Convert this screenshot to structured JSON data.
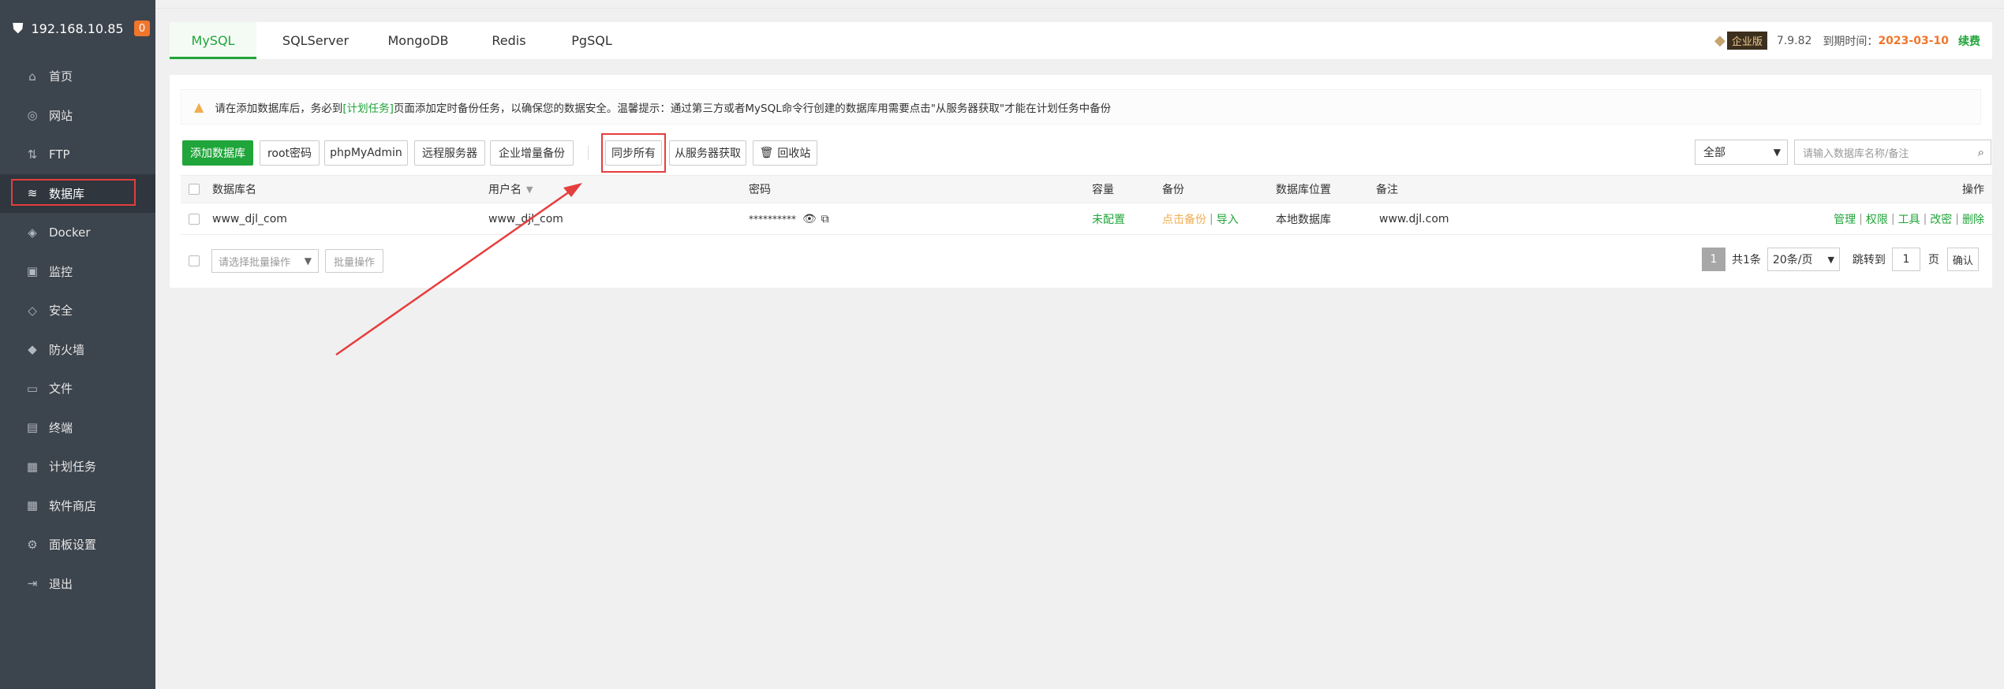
{
  "sidebar": {
    "ip": "192.168.10.85",
    "badge": "0",
    "items": [
      {
        "label": "首页",
        "icon": "home-icon",
        "glyph": "⌂"
      },
      {
        "label": "网站",
        "icon": "globe-icon",
        "glyph": "◎"
      },
      {
        "label": "FTP",
        "icon": "ftp-icon",
        "glyph": "⇅"
      },
      {
        "label": "数据库",
        "icon": "database-icon",
        "glyph": "≋"
      },
      {
        "label": "Docker",
        "icon": "docker-icon",
        "glyph": "◈"
      },
      {
        "label": "监控",
        "icon": "monitor-icon",
        "glyph": "▣"
      },
      {
        "label": "安全",
        "icon": "shield-icon",
        "glyph": "◇"
      },
      {
        "label": "防火墙",
        "icon": "firewall-icon",
        "glyph": "◆"
      },
      {
        "label": "文件",
        "icon": "folder-icon",
        "glyph": "▭"
      },
      {
        "label": "终端",
        "icon": "terminal-icon",
        "glyph": "▤"
      },
      {
        "label": "计划任务",
        "icon": "calendar-icon",
        "glyph": "▦"
      },
      {
        "label": "软件商店",
        "icon": "apps-icon",
        "glyph": "▦"
      },
      {
        "label": "面板设置",
        "icon": "gear-icon",
        "glyph": "⚙"
      },
      {
        "label": "退出",
        "icon": "logout-icon",
        "glyph": "⇥"
      }
    ]
  },
  "tabs": [
    "MySQL",
    "SQLServer",
    "MongoDB",
    "Redis",
    "PgSQL"
  ],
  "version": {
    "edition": "企业版",
    "number": "7.9.82",
    "expire_label": "到期时间：",
    "expire_date": "2023-03-10",
    "renew": "续费"
  },
  "notice": {
    "prefix": "请在添加数据库后，务必到",
    "link": "[计划任务]",
    "suffix": "页面添加定时备份任务，以确保您的数据安全。温馨提示：通过第三方或者MySQL命令行创建的数据库用需要点击\"从服务器获取\"才能在计划任务中备份"
  },
  "toolbar": {
    "add": "添加数据库",
    "root": "root密码",
    "pma": "phpMyAdmin",
    "remote": "远程服务器",
    "enterprise_backup": "企业增量备份",
    "sync_all": "同步所有",
    "from_server": "从服务器获取",
    "recycle": "回收站",
    "filter": "全部",
    "search_placeholder": "请输入数据库名称/备注"
  },
  "table": {
    "headers": {
      "name": "数据库名",
      "user": "用户名",
      "password": "密码",
      "capacity": "容量",
      "backup": "备份",
      "location": "数据库位置",
      "remark": "备注",
      "actions": "操作"
    },
    "rows": [
      {
        "name": "www_djl_com",
        "user": "www_djl_com",
        "password": "**********",
        "capacity": "未配置",
        "backup_click": "点击备份",
        "backup_import": "导入",
        "location": "本地数据库",
        "remark": "www.djl.com",
        "actions": [
          "管理",
          "权限",
          "工具",
          "改密",
          "删除"
        ]
      }
    ]
  },
  "footer": {
    "batch_placeholder": "请选择批量操作",
    "batch_button": "批量操作",
    "page": "1",
    "total": "共1条",
    "per_page": "20条/页",
    "jump_label": "跳转到",
    "jump_value": "1",
    "page_unit": "页",
    "confirm": "确认"
  }
}
